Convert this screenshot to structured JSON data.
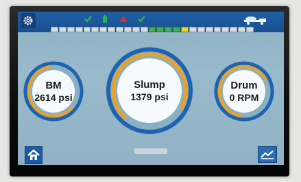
{
  "gauges": {
    "bm": {
      "title": "BM",
      "value": "2614 psi"
    },
    "slump": {
      "title": "Slump",
      "value": "1379 psi"
    },
    "drum": {
      "title": "Drum",
      "value": "0 RPM"
    }
  },
  "segment_bar": {
    "total_segments": 25,
    "green_segments": [
      12,
      13,
      14,
      15
    ],
    "yellow_segment": 16
  },
  "icons": {
    "settings": "gear-icon",
    "home": "home-icon",
    "truck": "truck-icon",
    "chart": "chart-icon"
  },
  "colors": {
    "top_bar": "#1d5fa8",
    "gauge_blue": "#1d63b0",
    "gauge_orange": "#f0a020",
    "screen_bg": "#93b5c6"
  }
}
